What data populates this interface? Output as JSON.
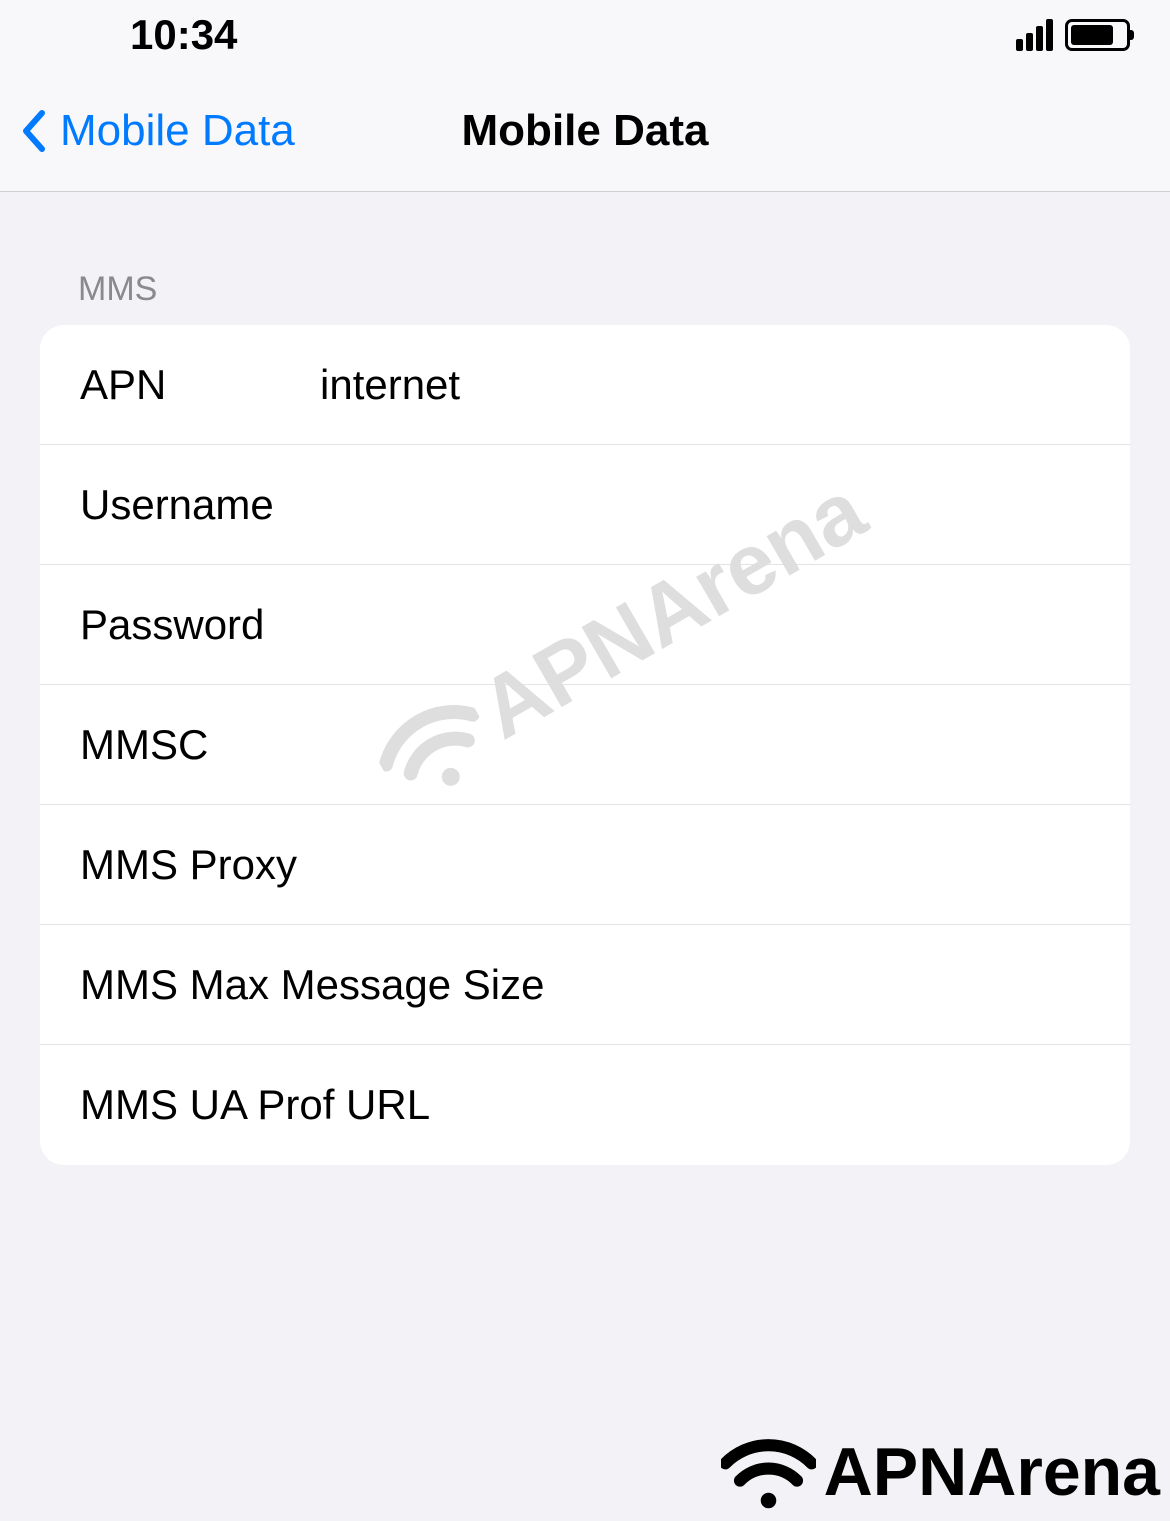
{
  "statusbar": {
    "time": "10:34"
  },
  "navbar": {
    "back_label": "Mobile Data",
    "title": "Mobile Data"
  },
  "section": {
    "header": "MMS",
    "rows": [
      {
        "label": "APN",
        "value": "internet"
      },
      {
        "label": "Username",
        "value": ""
      },
      {
        "label": "Password",
        "value": ""
      },
      {
        "label": "MMSC",
        "value": ""
      },
      {
        "label": "MMS Proxy",
        "value": ""
      },
      {
        "label": "MMS Max Message Size",
        "value": ""
      },
      {
        "label": "MMS UA Prof URL",
        "value": ""
      }
    ]
  },
  "watermark": {
    "text": "APNArena"
  }
}
